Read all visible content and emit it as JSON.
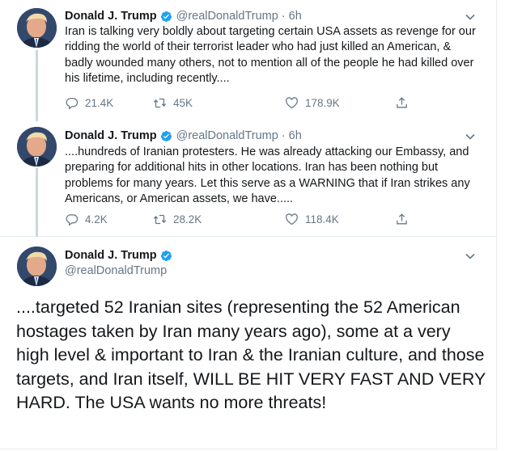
{
  "colors": {
    "verified": "#1da1f2",
    "secondary_text": "#657786",
    "divider": "#e6ecf0",
    "thread_line": "#ccd6dd"
  },
  "tweets": [
    {
      "author": "Donald J. Trump",
      "handle": "@realDonaldTrump",
      "separator": "·",
      "time": "6h",
      "text": "Iran is talking very boldly about targeting certain USA assets as revenge for our ridding the world of their terrorist leader who had just killed an American, & badly wounded many others, not to mention all of the people he had killed over his lifetime, including recently....",
      "replies": "21.4K",
      "retweets": "45K",
      "likes": "178.9K",
      "icons": [
        "reply-icon",
        "retweet-icon",
        "like-icon",
        "share-icon",
        "chevron-down-icon",
        "verified-badge-icon"
      ]
    },
    {
      "author": "Donald J. Trump",
      "handle": "@realDonaldTrump",
      "separator": "·",
      "time": "6h",
      "text": "....hundreds of Iranian protesters. He was already attacking our Embassy, and preparing for additional hits in other locations. Iran has been nothing but problems for many years. Let this serve as a WARNING that if Iran strikes any Americans, or American assets, we have.....",
      "replies": "4.2K",
      "retweets": "28.2K",
      "likes": "118.4K",
      "icons": [
        "reply-icon",
        "retweet-icon",
        "like-icon",
        "share-icon",
        "chevron-down-icon",
        "verified-badge-icon"
      ]
    },
    {
      "author": "Donald J. Trump",
      "handle": "@realDonaldTrump",
      "text": "....targeted 52 Iranian sites (representing the 52 American hostages taken by Iran many years ago), some at a very high level & important to Iran &  the Iranian culture, and those targets, and Iran itself, WILL BE HIT VERY FAST AND VERY HARD. The USA wants no more threats!",
      "icons": [
        "chevron-down-icon",
        "verified-badge-icon"
      ]
    }
  ]
}
